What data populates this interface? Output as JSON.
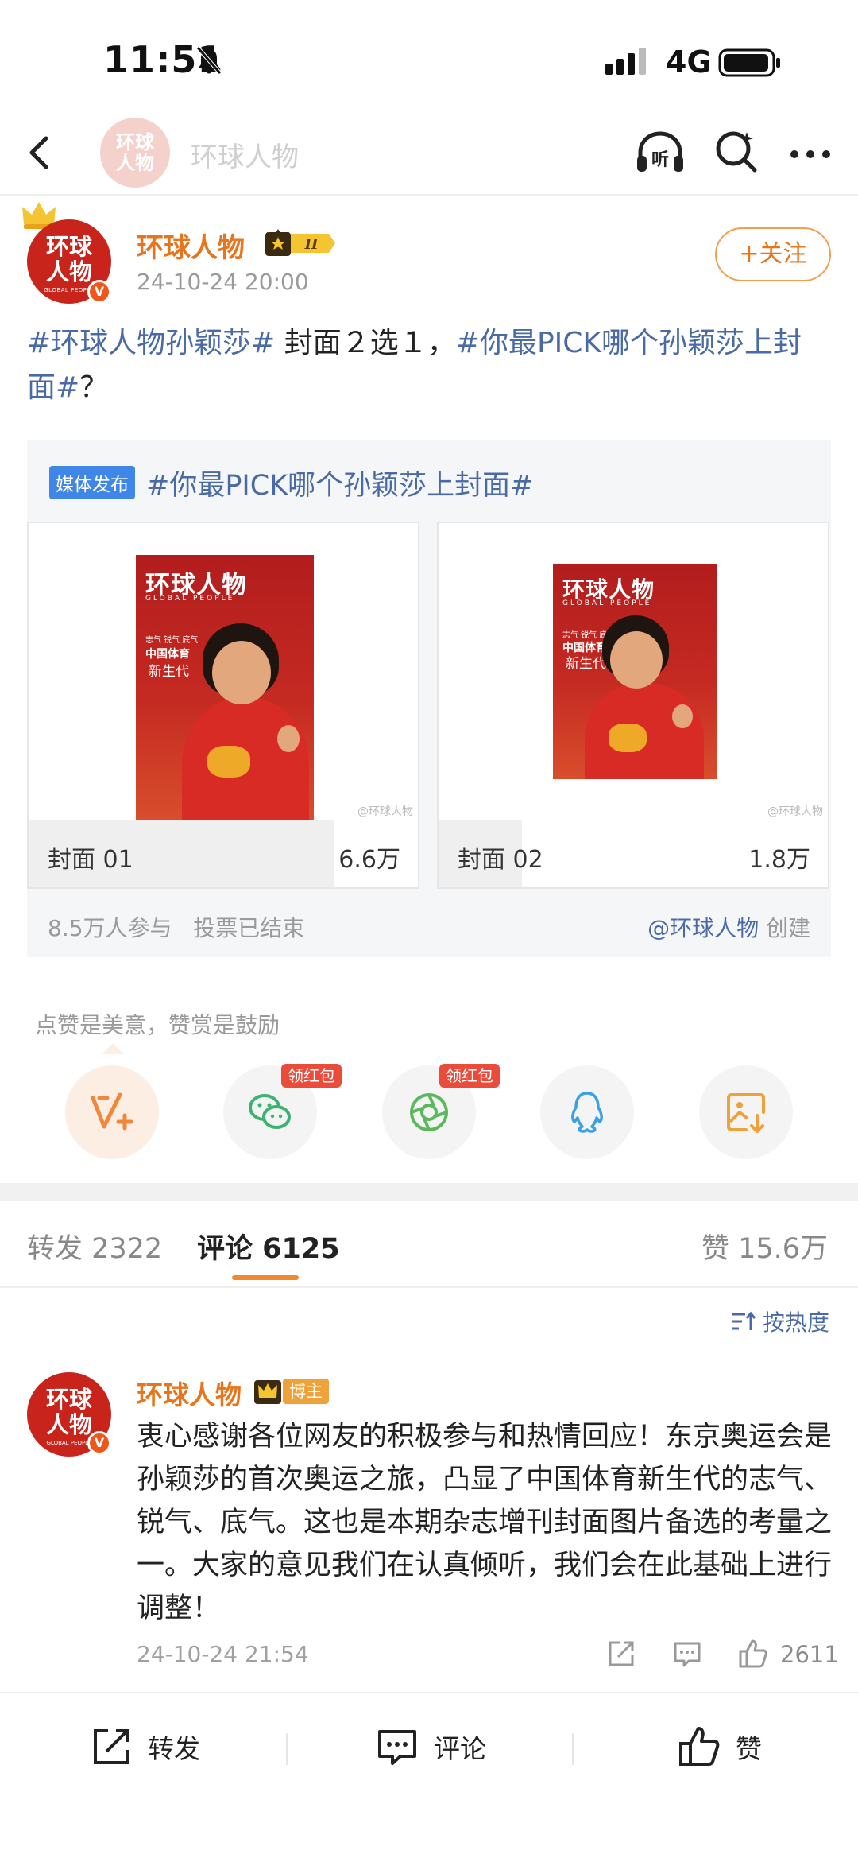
{
  "status_bar": {
    "time": "11:51",
    "network": "4G"
  },
  "nav": {
    "title": "环球人物",
    "avatar_text_1": "环球",
    "avatar_text_2": "人物"
  },
  "post": {
    "author": "环球人物",
    "avatar_text_1": "环球",
    "avatar_text_2": "人物",
    "avatar_sub": "GLOBAL PEOPLE",
    "verified_mark": "V",
    "member_level": "II",
    "time": "24-10-24 20:00",
    "follow_label": "+关注",
    "text_parts": {
      "hashtag1": "#环球人物孙颖莎#",
      "middle": " 封面２选１，",
      "hashtag2": "#你最PICK哪个孙颖莎上封面#",
      "end": "？"
    }
  },
  "poll": {
    "badge": "媒体发布",
    "title": "#你最PICK哪个孙颖莎上封面#",
    "options": [
      {
        "label": "封面 01",
        "count": "6.6万",
        "share": 0.785
      },
      {
        "label": "封面 02",
        "count": "1.8万",
        "share": 0.215
      }
    ],
    "cover_masthead": "环球人物",
    "cover_sub": "GLOBAL PEOPLE",
    "cover_tag1": "志气 锐气 底气",
    "cover_tag2": "中国体育",
    "cover_tag3": "新生代",
    "watermark": "@环球人物",
    "participants": "8.5万人参与",
    "status": "投票已结束",
    "creator_name": "@环球人物",
    "creator_suffix": " 创建"
  },
  "reward": {
    "text": "点赞是美意，赞赏是鼓励",
    "redpack_label": "领红包"
  },
  "tabs": {
    "repost": "转发 2322",
    "comment": "评论 6125",
    "like": "赞 15.6万"
  },
  "sort": {
    "label": "按热度"
  },
  "comment": {
    "author": "环球人物",
    "badge": "博主",
    "avatar_text_1": "环球",
    "avatar_text_2": "人物",
    "avatar_sub": "GLOBAL PEOPLE",
    "verified_mark": "V",
    "text": "衷心感谢各位网友的积极参与和热情回应！东京奥运会是孙颖莎的首次奥运之旅，凸显了中国体育新生代的志气、锐气、底气。这也是本期杂志增刊封面图片备选的考量之一。大家的意见我们在认真倾听，我们会在此基础上进行调整！",
    "time": "24-10-24 21:54",
    "like_count": "2611"
  },
  "bottom_bar": {
    "repost": "转发",
    "comment": "评论",
    "like": "赞"
  },
  "colors": {
    "accent_orange": "#e8741b",
    "link_blue": "#4a6aa5",
    "media_badge_blue": "#3f86e6",
    "avatar_red": "#c9241c"
  }
}
